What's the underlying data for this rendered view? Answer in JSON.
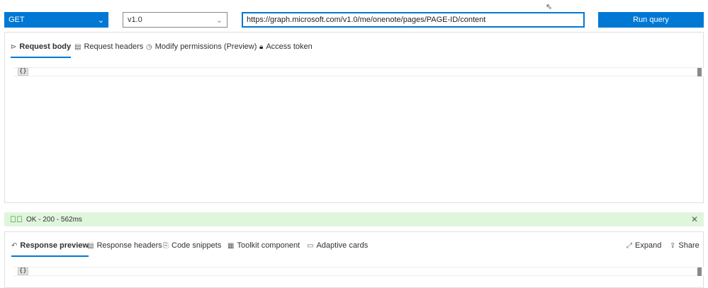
{
  "query": {
    "method": "GET",
    "version": "v1.0",
    "url": "https://graph.microsoft.com/v1.0/me/onenote/pages/PAGE-ID/content",
    "run_label": "Run query"
  },
  "request_tabs": [
    {
      "label": "Request body"
    },
    {
      "label": "Request headers"
    },
    {
      "label": "Modify permissions (Preview)"
    },
    {
      "label": "Access token"
    }
  ],
  "request_body": "{}",
  "status": {
    "text": "OK - 200 - 562ms",
    "color": "#dff6dd"
  },
  "response_tabs": [
    {
      "label": "Response preview"
    },
    {
      "label": "Response headers"
    },
    {
      "label": "Code snippets"
    },
    {
      "label": "Toolkit component"
    },
    {
      "label": "Adaptive cards"
    }
  ],
  "response_actions": {
    "expand": "Expand",
    "share": "Share"
  },
  "response_body": "{}",
  "colors": {
    "accent": "#0078d4"
  }
}
